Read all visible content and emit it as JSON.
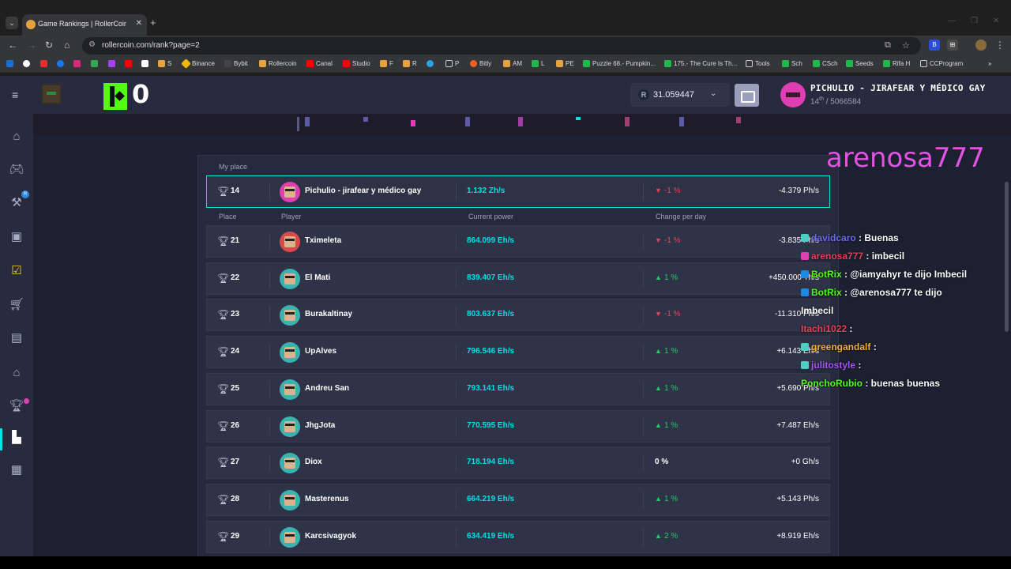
{
  "browser": {
    "tab_title": "Game Rankings | RollerCoin.com",
    "url": "rollercoin.com/rank?page=2",
    "bookmarks": [
      "Binance",
      "Bybit",
      "Rollercoin",
      "Canal",
      "Studio",
      "F",
      "R",
      "P",
      "Bitly",
      "AM",
      "L",
      "PE",
      "Puzzle 68.- Pumpkin...",
      "175.- The Cure Is Th...",
      "Tools",
      "Sch",
      "CSch",
      "Seeds",
      "Rifa H",
      "CCProgram"
    ]
  },
  "stream": {
    "kick_count": "0",
    "overlay_title": "arenosa777",
    "chat": [
      {
        "user": "davidcaro",
        "text": " : Buenas",
        "color": "#6a6cf0",
        "badge": "#4dd0c4"
      },
      {
        "user": "arenosa777",
        "text": " : imbecil",
        "color": "#e2445c",
        "badge": "#e03fb3"
      },
      {
        "user": "BotRix",
        "text": " : @iamyahyr te dijo Imbecil",
        "color": "#53fc18",
        "badge": "#1e88e5"
      },
      {
        "user": "BotRix",
        "text": " : @arenosa777 te dijo",
        "color": "#53fc18",
        "badge": "#1e88e5"
      },
      {
        "user": "",
        "text": "Imbecil",
        "color": "#ffffff",
        "badge": ""
      },
      {
        "user": "Itachi1022",
        "text": " :",
        "color": "#e2445c",
        "badge": ""
      },
      {
        "user": "greengandalf",
        "text": " :",
        "color": "#f0b13c",
        "badge": "#4dd0c4"
      },
      {
        "user": "julitostyle",
        "text": " :",
        "color": "#a855f7",
        "badge": "#4dd0c4"
      },
      {
        "user": "PonchoRubio",
        "text": " : buenas buenas",
        "color": "#53fc18",
        "badge": ""
      }
    ]
  },
  "header": {
    "balance_icon": "R",
    "balance": "31.059447",
    "user_name": "PICHULIO - JIRAFEAR Y MÉDICO GAY",
    "rank_num": "14",
    "rank_suffix": "th",
    "rank_total": " / 5066584"
  },
  "ranking": {
    "my_place_label": "My place",
    "my_place": {
      "place": "14",
      "name": "Pichulio - jirafear y médico gay",
      "power": "1.132 Zh/s",
      "trend": "down",
      "arrow": "▼",
      "pct": "-1 %",
      "delta": "-4.379 Ph/s"
    },
    "columns": {
      "place": "Place",
      "player": "Player",
      "power": "Current power",
      "change": "Change per day"
    },
    "rows": [
      {
        "place": "21",
        "name": "Tximeleta",
        "power": "864.099 Eh/s",
        "trend": "down",
        "arrow": "▼",
        "pct": "-1 %",
        "delta": "-3.835 Ph/s"
      },
      {
        "place": "22",
        "name": "El Mati",
        "power": "839.407 Eh/s",
        "trend": "up",
        "arrow": "▲",
        "pct": "1 %",
        "delta": "+450.000 Th/s"
      },
      {
        "place": "23",
        "name": "Burakaltinay",
        "power": "803.637 Eh/s",
        "trend": "down",
        "arrow": "▼",
        "pct": "-1 %",
        "delta": "-11.310 Ph/s"
      },
      {
        "place": "24",
        "name": "UpAlves",
        "power": "796.546 Eh/s",
        "trend": "up",
        "arrow": "▲",
        "pct": "1 %",
        "delta": "+6.143 Eh/s"
      },
      {
        "place": "25",
        "name": "Andreu San",
        "power": "793.141 Eh/s",
        "trend": "up",
        "arrow": "▲",
        "pct": "1 %",
        "delta": "+5.690 Ph/s"
      },
      {
        "place": "26",
        "name": "JhgJota",
        "power": "770.595 Eh/s",
        "trend": "up",
        "arrow": "▲",
        "pct": "1 %",
        "delta": "+7.487 Eh/s"
      },
      {
        "place": "27",
        "name": "Diox",
        "power": "718.194 Eh/s",
        "trend": "flat",
        "arrow": "",
        "pct": "0 %",
        "delta": "+0 Gh/s"
      },
      {
        "place": "28",
        "name": "Masterenus",
        "power": "664.219 Eh/s",
        "trend": "up",
        "arrow": "▲",
        "pct": "1 %",
        "delta": "+5.143 Ph/s"
      },
      {
        "place": "29",
        "name": "Karcsivagyok",
        "power": "634.419 Eh/s",
        "trend": "up",
        "arrow": "▲",
        "pct": "2 %",
        "delta": "+8.919 Eh/s"
      }
    ]
  },
  "colors": {
    "accent": "#03e1e4",
    "up": "#27c96b",
    "down": "#e2445c",
    "kick": "#53fc18",
    "overlay": "#e153e3"
  }
}
